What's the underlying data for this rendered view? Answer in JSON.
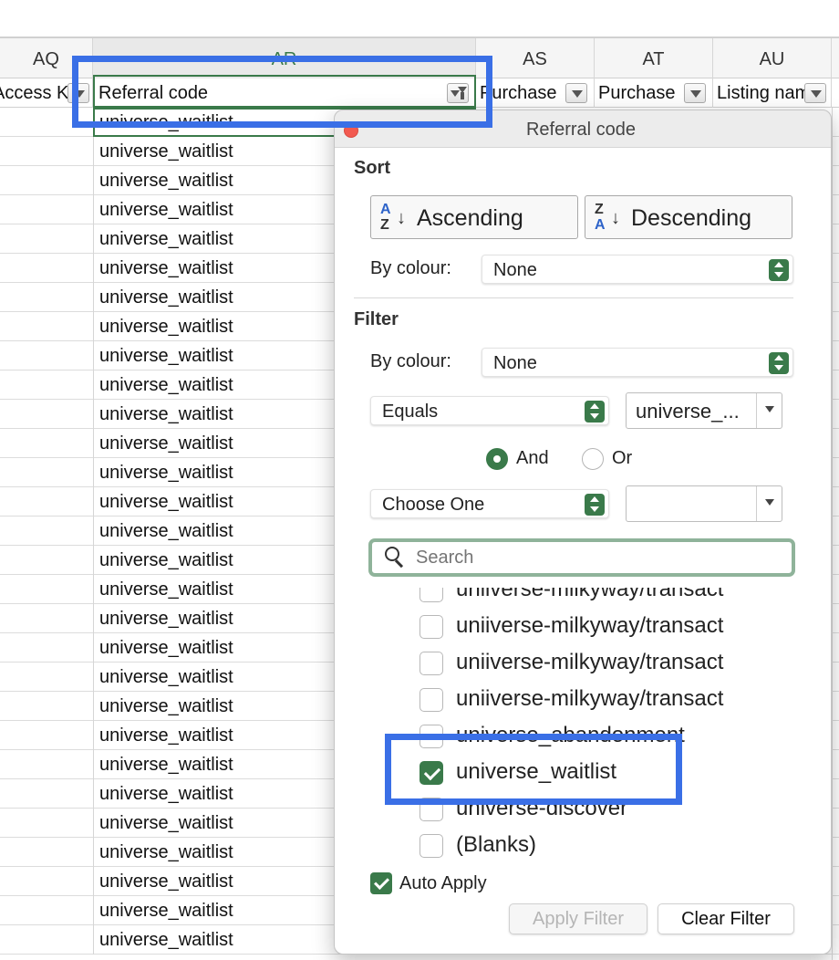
{
  "columns": {
    "letters": [
      "AQ",
      "AR",
      "AS",
      "AT",
      "AU"
    ],
    "headers": [
      "Access Key",
      "Referral code",
      "Purchase",
      "Purchase",
      "Listing name"
    ]
  },
  "rows": {
    "value": "universe_waitlist",
    "count": 29
  },
  "popover": {
    "title": "Referral code",
    "sort": {
      "label": "Sort",
      "ascending": "Ascending",
      "descending": "Descending",
      "az_top": "A",
      "az_bottom": "Z",
      "za_top": "Z",
      "za_bottom": "A",
      "arrow": "↓",
      "by_colour_label": "By colour:",
      "by_colour_value": "None"
    },
    "filter": {
      "label": "Filter",
      "by_colour_label": "By colour:",
      "by_colour_value": "None",
      "condition1": "Equals",
      "value1": "universe_...",
      "and_label": "And",
      "or_label": "Or",
      "condition2": "Choose One",
      "value2": ""
    },
    "search": {
      "placeholder": "Search"
    },
    "list": {
      "items": [
        {
          "label": "uniiverse-milkyway/transact",
          "checked": false
        },
        {
          "label": "uniiverse-milkyway/transact",
          "checked": false
        },
        {
          "label": "uniiverse-milkyway/transact",
          "checked": false
        },
        {
          "label": "uniiverse-milkyway/transact",
          "checked": false
        },
        {
          "label": "universe_abandonment",
          "checked": false
        },
        {
          "label": "universe_waitlist",
          "checked": true
        },
        {
          "label": "universe-discover",
          "checked": false
        },
        {
          "label": "(Blanks)",
          "checked": false
        }
      ]
    },
    "auto_apply": "Auto Apply",
    "apply_filter": "Apply Filter",
    "clear_filter": "Clear Filter"
  },
  "colors": {
    "accent": "#3a7a4a",
    "annotation": "#3a6fe6",
    "close": "#f25a50"
  }
}
